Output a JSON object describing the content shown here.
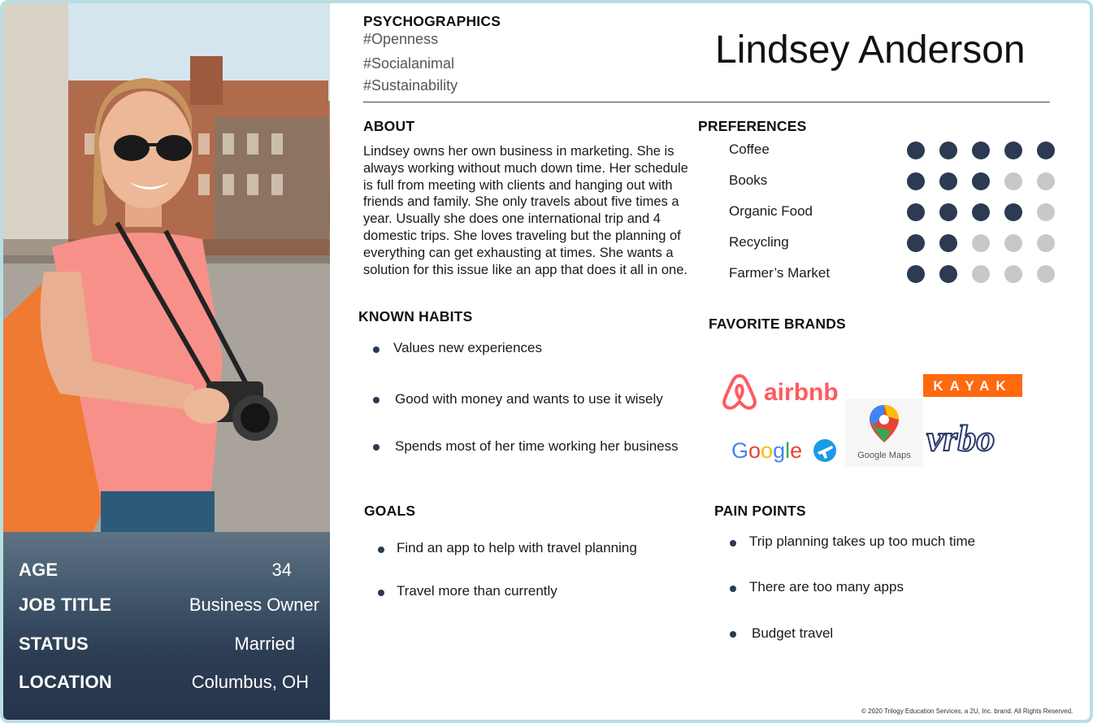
{
  "persona": {
    "name": "Lindsey Anderson",
    "photo_alt": "woman-traveler-photo"
  },
  "stats": {
    "age_label": "AGE",
    "age_value": "34",
    "job_label": "JOB TITLE",
    "job_value": "Business Owner",
    "status_label": "STATUS",
    "status_value": "Married",
    "location_label": "LOCATION",
    "location_value": "Columbus, OH"
  },
  "psychographics": {
    "heading": "PSYCHOGRAPHICS",
    "tags": [
      "#Openness",
      "#Socialanimal",
      "#Sustainability"
    ]
  },
  "about": {
    "heading": "ABOUT",
    "text": "Lindsey owns her own business in marketing. She is always working without much down time. Her schedule is full from meeting with clients and hanging out with friends and family. She only travels about five times a year. Usually she does one international trip and 4 domestic trips. She loves traveling but the planning of everything can get exhausting at times. She wants a solution for this issue like an app that does it all in one."
  },
  "preferences": {
    "heading": "PREFERENCES",
    "items": [
      {
        "label": "Coffee",
        "level": 5
      },
      {
        "label": "Books",
        "level": 3
      },
      {
        "label": "Organic Food",
        "level": 4
      },
      {
        "label": "Recycling",
        "level": 2
      },
      {
        "label": "Farmer’s Market",
        "level": 2
      }
    ],
    "max": 5,
    "filled_color": "#2c3a52",
    "empty_color": "#c8c8c8"
  },
  "known_habits": {
    "heading": "KNOWN HABITS",
    "items": [
      "Values new experiences",
      "Good with money and wants to use it wisely",
      "Spends most of her time working her business"
    ]
  },
  "favorite_brands": {
    "heading": "FAVORITE BRANDS",
    "brands": [
      {
        "name": "airbnb",
        "icon": "airbnb-logo",
        "color": "#ff5a5f"
      },
      {
        "name": "KAYAK",
        "icon": "kayak-logo",
        "color": "#ff690f"
      },
      {
        "name": "Google",
        "icon": "google-flights-logo",
        "color": "#4285f4"
      },
      {
        "name": "Google Maps",
        "icon": "google-maps-logo",
        "color": "#34a853"
      },
      {
        "name": "vrbo",
        "icon": "vrbo-logo",
        "color": "#2a3a6a"
      }
    ]
  },
  "goals": {
    "heading": "GOALS",
    "items": [
      "Find an app to help with travel planning",
      "Travel more than currently"
    ]
  },
  "pain_points": {
    "heading": "PAIN POINTS",
    "items": [
      "Trip planning takes up too much time",
      "There are too many apps",
      "Budget travel"
    ]
  },
  "footer": {
    "copyright": "© 2020 Trilogy Education Services, a 2U, Inc. brand. All Rights Reserved."
  }
}
